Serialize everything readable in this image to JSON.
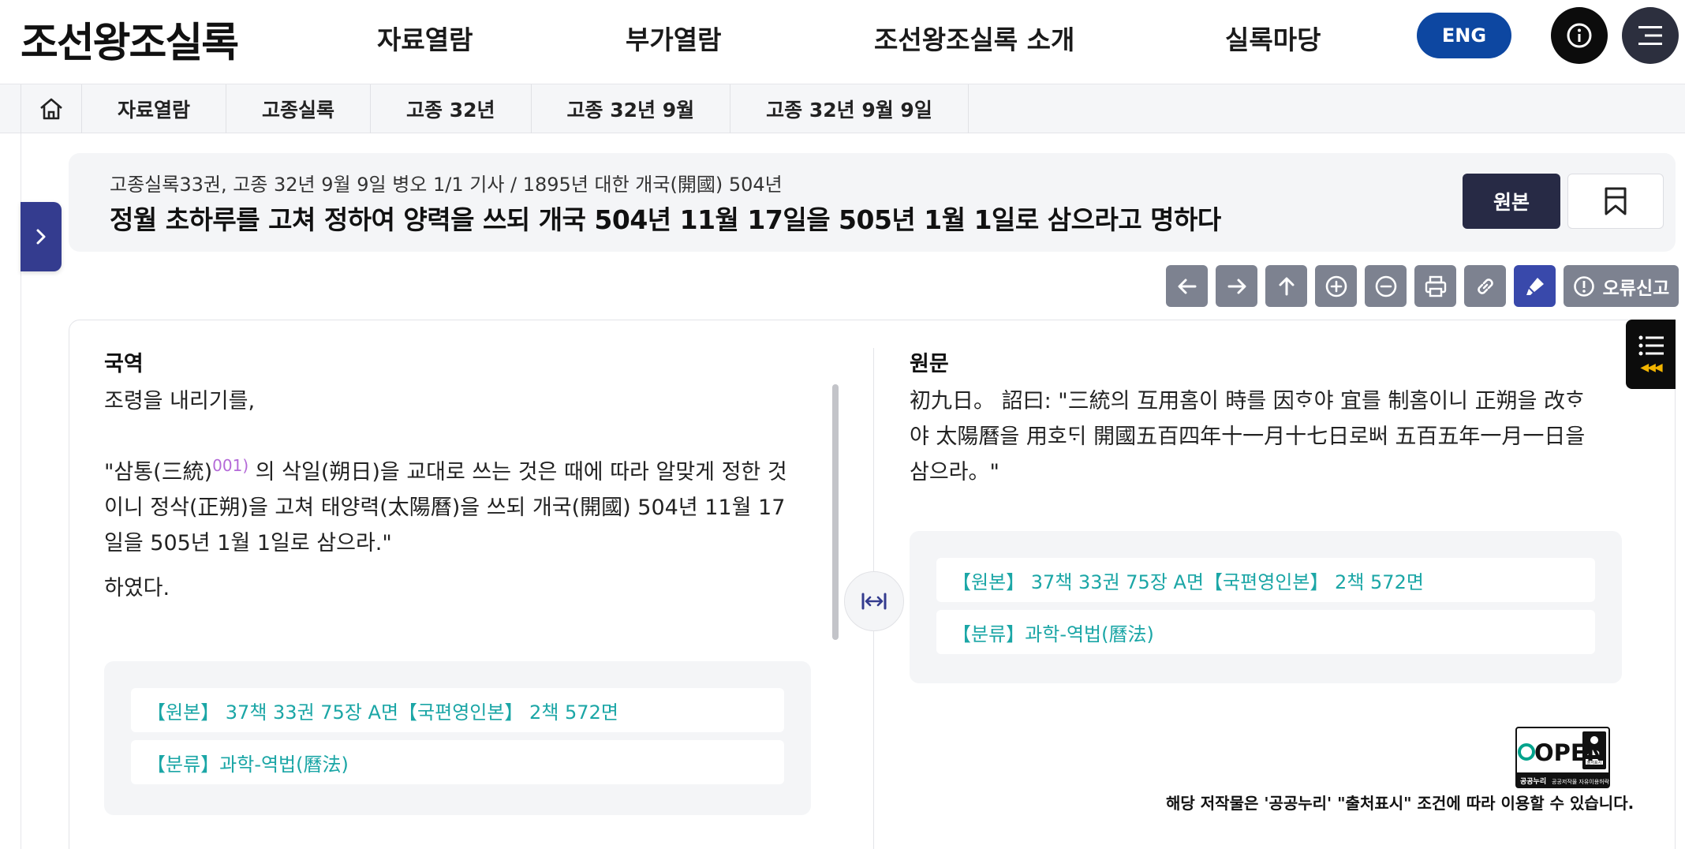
{
  "header": {
    "logo": "조선왕조실록",
    "nav": [
      "자료열람",
      "부가열람",
      "조선왕조실록 소개",
      "실록마당"
    ],
    "eng_label": "ENG"
  },
  "breadcrumb": [
    "자료열람",
    "고종실록",
    "고종 32년",
    "고종 32년 9월",
    "고종 32년 9월 9일"
  ],
  "article": {
    "meta": "고종실록33권, 고종 32년 9월 9일 병오 1/1 기사 / 1895년 대한 개국(開國) 504년",
    "title": "정월 초하루를 고쳐 정하여 양력을 쓰되 개국 504년 11월 17일을 505년 1월 1일로 삼으라고 명하다",
    "original_label": "원본"
  },
  "toolbar": {
    "report_label": "오류신고",
    "icons": [
      "arrow-left-icon",
      "arrow-right-icon",
      "arrow-up-icon",
      "zoom-in-icon",
      "zoom-out-icon",
      "print-icon",
      "link-icon",
      "highlighter-icon",
      "alert-icon"
    ]
  },
  "translation": {
    "heading": "국역",
    "line1": "조령을 내리기를,",
    "p2_before": "\"삼통(三統)",
    "p2_footnote": "001)",
    "p2_after": " 의 삭일(朔日)을 교대로 쓰는 것은 때에 따라 알맞게 정한 것이니 정삭(正朔)을 고쳐 태양력(太陽曆)을 쓰되 개국(開國) 504년 11월 17일을 505년 1월 1일로 삼으라.\"",
    "line3": "하였다.",
    "ref_source": "【원본】 37책 33권 75장 A면【국편영인본】 2책 572면",
    "ref_category": "【분류】과학-역법(曆法)"
  },
  "original": {
    "heading": "원문",
    "text": "初九日。 詔曰: \"三統의 互用홈이 時를 因ᄒᆞ야 宜를 制홈이니 正朔을 改ᄒᆞ야 太陽曆을 用호ᄃᆡ 開國五百四年十一月十七日로ᄡᅥ 五百五年一月一日을 삼으라。\"",
    "ref_source": "【원본】 37책 33권 75장 A면【국편영인본】 2책 572면",
    "ref_category": "【분류】과학-역법(曆法)"
  },
  "license": {
    "kogl_open": "OPEN",
    "kogl_left": "공공누리",
    "kogl_right": "공공저작물 자유이용허락",
    "kogl_badge": "출처표시",
    "notice": "해당 저작물은 '공공누리' \"출처표시\" 조건에 따라 이용할 수 있습니다."
  },
  "colors": {
    "brand_navy": "#272a45",
    "eng_blue": "#0d47a1",
    "toggle_indigo": "#343c8f",
    "ref_teal": "#1ba6a6",
    "footnote_purple": "#b46ad8"
  }
}
